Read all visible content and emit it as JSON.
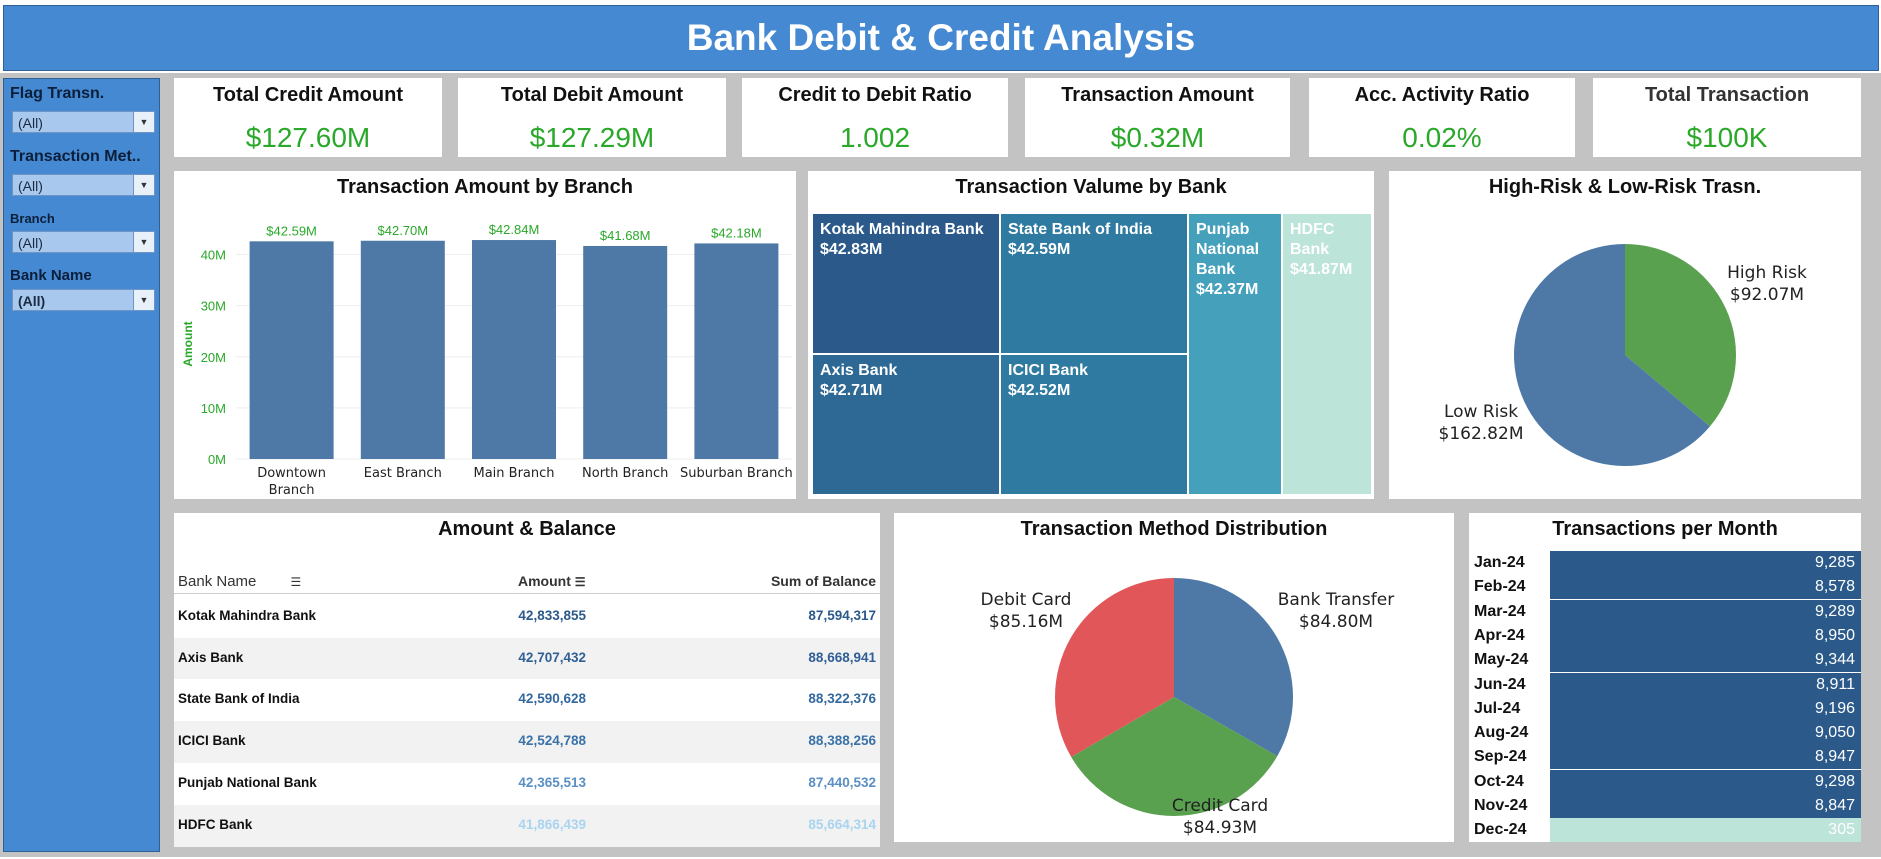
{
  "dashboard": {
    "title": "Bank Debit & Credit Analysis"
  },
  "filters": [
    {
      "label": "Flag Transn.",
      "value": "(All)"
    },
    {
      "label": "Transaction Met..",
      "value": "(All)"
    },
    {
      "label": "Branch",
      "value": "(All)"
    },
    {
      "label": "Bank Name",
      "value": "(All)"
    }
  ],
  "kpis": [
    {
      "title": "Total Credit Amount",
      "value": "$127.60M"
    },
    {
      "title": "Total Debit Amount",
      "value": "$127.29M"
    },
    {
      "title": "Credit to Debit Ratio",
      "value": "1.002"
    },
    {
      "title": "Transaction Amount",
      "value": "$0.32M"
    },
    {
      "title": "Acc. Activity Ratio",
      "value": "0.02%"
    },
    {
      "title": "Total Transaction",
      "value": "$100K"
    }
  ],
  "branch_chart": {
    "title": "Transaction Amount by Branch",
    "ylabel": "Amount",
    "ticks": [
      "0M",
      "10M",
      "20M",
      "30M",
      "40M"
    ],
    "categories": [
      "Downtown Branch",
      "East Branch",
      "Main Branch",
      "North Branch",
      "Suburban Branch"
    ],
    "values": [
      42.59,
      42.7,
      42.84,
      41.68,
      42.18
    ],
    "labels": [
      "$42.59M",
      "$42.70M",
      "$42.84M",
      "$41.68M",
      "$42.18M"
    ],
    "bar_color": "#4e79a7",
    "label_color": "#2aa82a"
  },
  "treemap": {
    "title": "Transaction Valume by Bank",
    "cells": [
      {
        "name": "Kotak Mahindra Bank",
        "value": "$42.83M",
        "color": "#2b5a8a"
      },
      {
        "name": "State Bank of India",
        "value": "$42.59M",
        "color": "#2f7aa1"
      },
      {
        "name": "Punjab National Bank",
        "value": "$42.37M",
        "color": "#45a0bb"
      },
      {
        "name": "HDFC Bank",
        "value": "$41.87M",
        "color": "#bce4d8"
      },
      {
        "name": "Axis Bank",
        "value": "$42.71M",
        "color": "#2d6994"
      },
      {
        "name": "ICICI Bank",
        "value": "$42.52M",
        "color": "#2f7aa1"
      }
    ]
  },
  "risk_chart": {
    "title": "High-Risk & Low-Risk Trasn.",
    "slices": [
      {
        "name": "High Risk",
        "value": 92.07,
        "label": "$92.07M",
        "color": "#59a14f"
      },
      {
        "name": "Low Risk",
        "value": 162.82,
        "label": "$162.82M",
        "color": "#4e79a7"
      }
    ]
  },
  "table": {
    "title": "Amount & Balance",
    "headers": [
      "Bank Name",
      "Amount",
      "Sum of Balance"
    ],
    "rows": [
      {
        "bank": "Kotak Mahindra Bank",
        "amount": "42,833,855",
        "balance": "87,594,317",
        "color": "#2b5a8a"
      },
      {
        "bank": "Axis Bank",
        "amount": "42,707,432",
        "balance": "88,668,941",
        "color": "#2f5f95"
      },
      {
        "bank": "State Bank of India",
        "amount": "42,590,628",
        "balance": "88,322,376",
        "color": "#34689d"
      },
      {
        "bank": "ICICI Bank",
        "amount": "42,524,788",
        "balance": "88,388,256",
        "color": "#3a72a8"
      },
      {
        "bank": "Punjab National Bank",
        "amount": "42,365,513",
        "balance": "87,440,532",
        "color": "#5a8fc4"
      },
      {
        "bank": "HDFC Bank",
        "amount": "41,866,439",
        "balance": "85,664,314",
        "color": "#a9d4ef"
      }
    ]
  },
  "method_chart": {
    "title": "Transaction Method Distribution",
    "slices": [
      {
        "name": "Bank Transfer",
        "value": 84.8,
        "label": "$84.80M",
        "color": "#4e79a7"
      },
      {
        "name": "Credit Card",
        "value": 84.93,
        "label": "$84.93M",
        "color": "#59a14f"
      },
      {
        "name": "Debit Card",
        "value": 85.16,
        "label": "$85.16M",
        "color": "#e15759"
      }
    ]
  },
  "monthly": {
    "title": "Transactions per Month",
    "rows": [
      {
        "month": "Jan-24",
        "count": "9,285",
        "color": "#2b5a8a"
      },
      {
        "month": "Feb-24",
        "count": "8,578",
        "color": "#2b5a8a"
      },
      {
        "month": "Mar-24",
        "count": "9,289",
        "color": "#2b5a8a"
      },
      {
        "month": "Apr-24",
        "count": "8,950",
        "color": "#2b5a8a"
      },
      {
        "month": "May-24",
        "count": "9,344",
        "color": "#2b5a8a"
      },
      {
        "month": "Jun-24",
        "count": "8,911",
        "color": "#2b5a8a"
      },
      {
        "month": "Jul-24",
        "count": "9,196",
        "color": "#2b5a8a"
      },
      {
        "month": "Aug-24",
        "count": "9,050",
        "color": "#2b5a8a"
      },
      {
        "month": "Sep-24",
        "count": "8,947",
        "color": "#2b5a8a"
      },
      {
        "month": "Oct-24",
        "count": "9,298",
        "color": "#2b5a8a"
      },
      {
        "month": "Nov-24",
        "count": "8,847",
        "color": "#2b5a8a"
      },
      {
        "month": "Dec-24",
        "count": "305",
        "color": "#bce4d8"
      }
    ]
  }
}
